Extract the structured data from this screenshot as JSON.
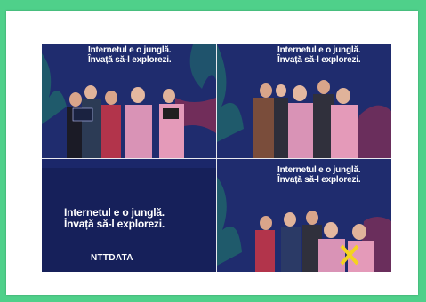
{
  "banner": {
    "line1": "Internetul e o junglă.",
    "line2": "Învață să-l explorezi."
  },
  "brand": {
    "logo_text": "NTTDATA"
  },
  "colors": {
    "page_border": "#4fd08a",
    "card": "#ffffff",
    "backdrop": "#1d2a6b",
    "logo_panel": "#16205a"
  }
}
